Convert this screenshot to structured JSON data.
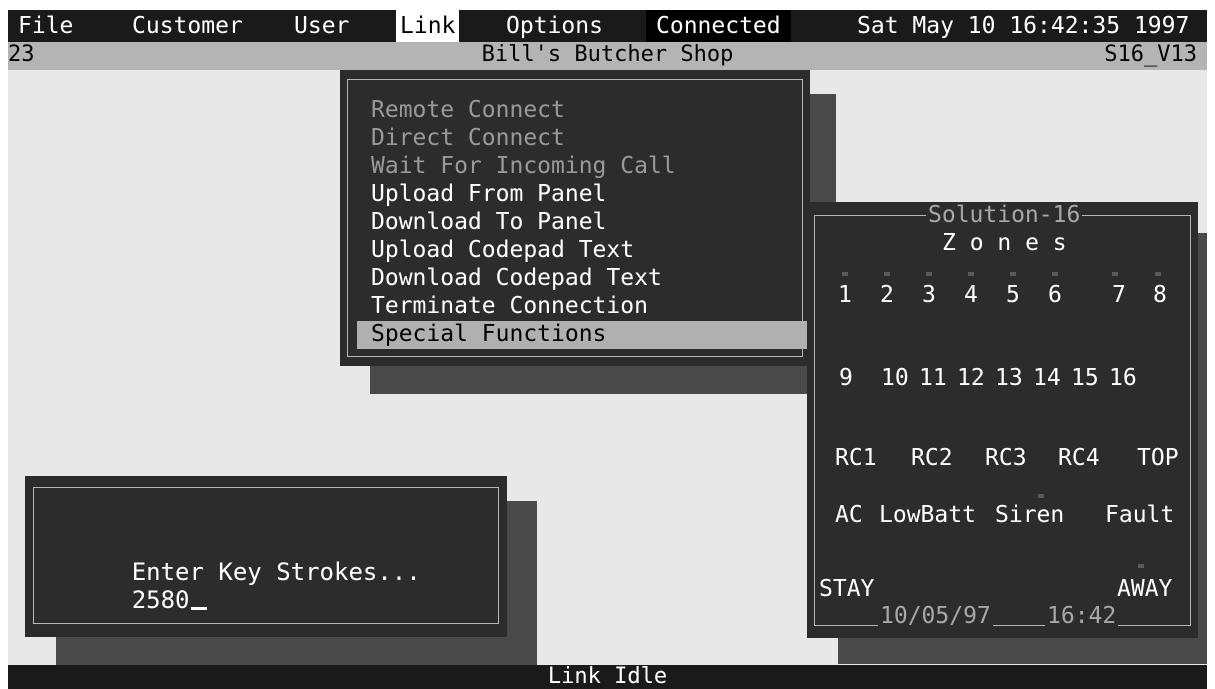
{
  "menubar": {
    "items": [
      "File",
      "Customer",
      "User",
      "Link",
      "Options"
    ],
    "status": "Connected",
    "datetime": "Sat May 10 16:42:35 1997"
  },
  "titlebar": {
    "left": "23",
    "title": "Bill's Butcher Shop",
    "right": "S16_V13"
  },
  "link_menu": {
    "items": [
      "Remote Connect",
      "Direct Connect",
      "Wait For Incoming Call",
      "Upload From Panel",
      "Download To Panel",
      "Upload Codepad Text",
      "Download Codepad Text",
      "Terminate Connection",
      "Special Functions"
    ],
    "disabled": [
      true,
      true,
      true,
      false,
      false,
      false,
      false,
      false,
      false
    ],
    "highlighted_index": 8
  },
  "panel": {
    "title": "Solution-16",
    "subtitle": "Z o n e s",
    "zones_row1": [
      "1",
      "2",
      "3",
      "4",
      "5",
      "6",
      "7",
      "8"
    ],
    "zones_row2": [
      "9",
      "10",
      "11",
      "12",
      "13",
      "14",
      "15",
      "16"
    ],
    "remote_row": [
      "RC1",
      "RC2",
      "RC3",
      "RC4",
      "TOP"
    ],
    "status_row": [
      "AC",
      "LowBatt",
      "Siren",
      "Fault"
    ],
    "stay_label": "STAY",
    "away_label": "AWAY",
    "date": "10/05/97",
    "time": "16:42"
  },
  "key_dialog": {
    "prompt": "Enter Key Strokes...",
    "value": "2580"
  },
  "statusbar": {
    "text": "Link Idle"
  }
}
